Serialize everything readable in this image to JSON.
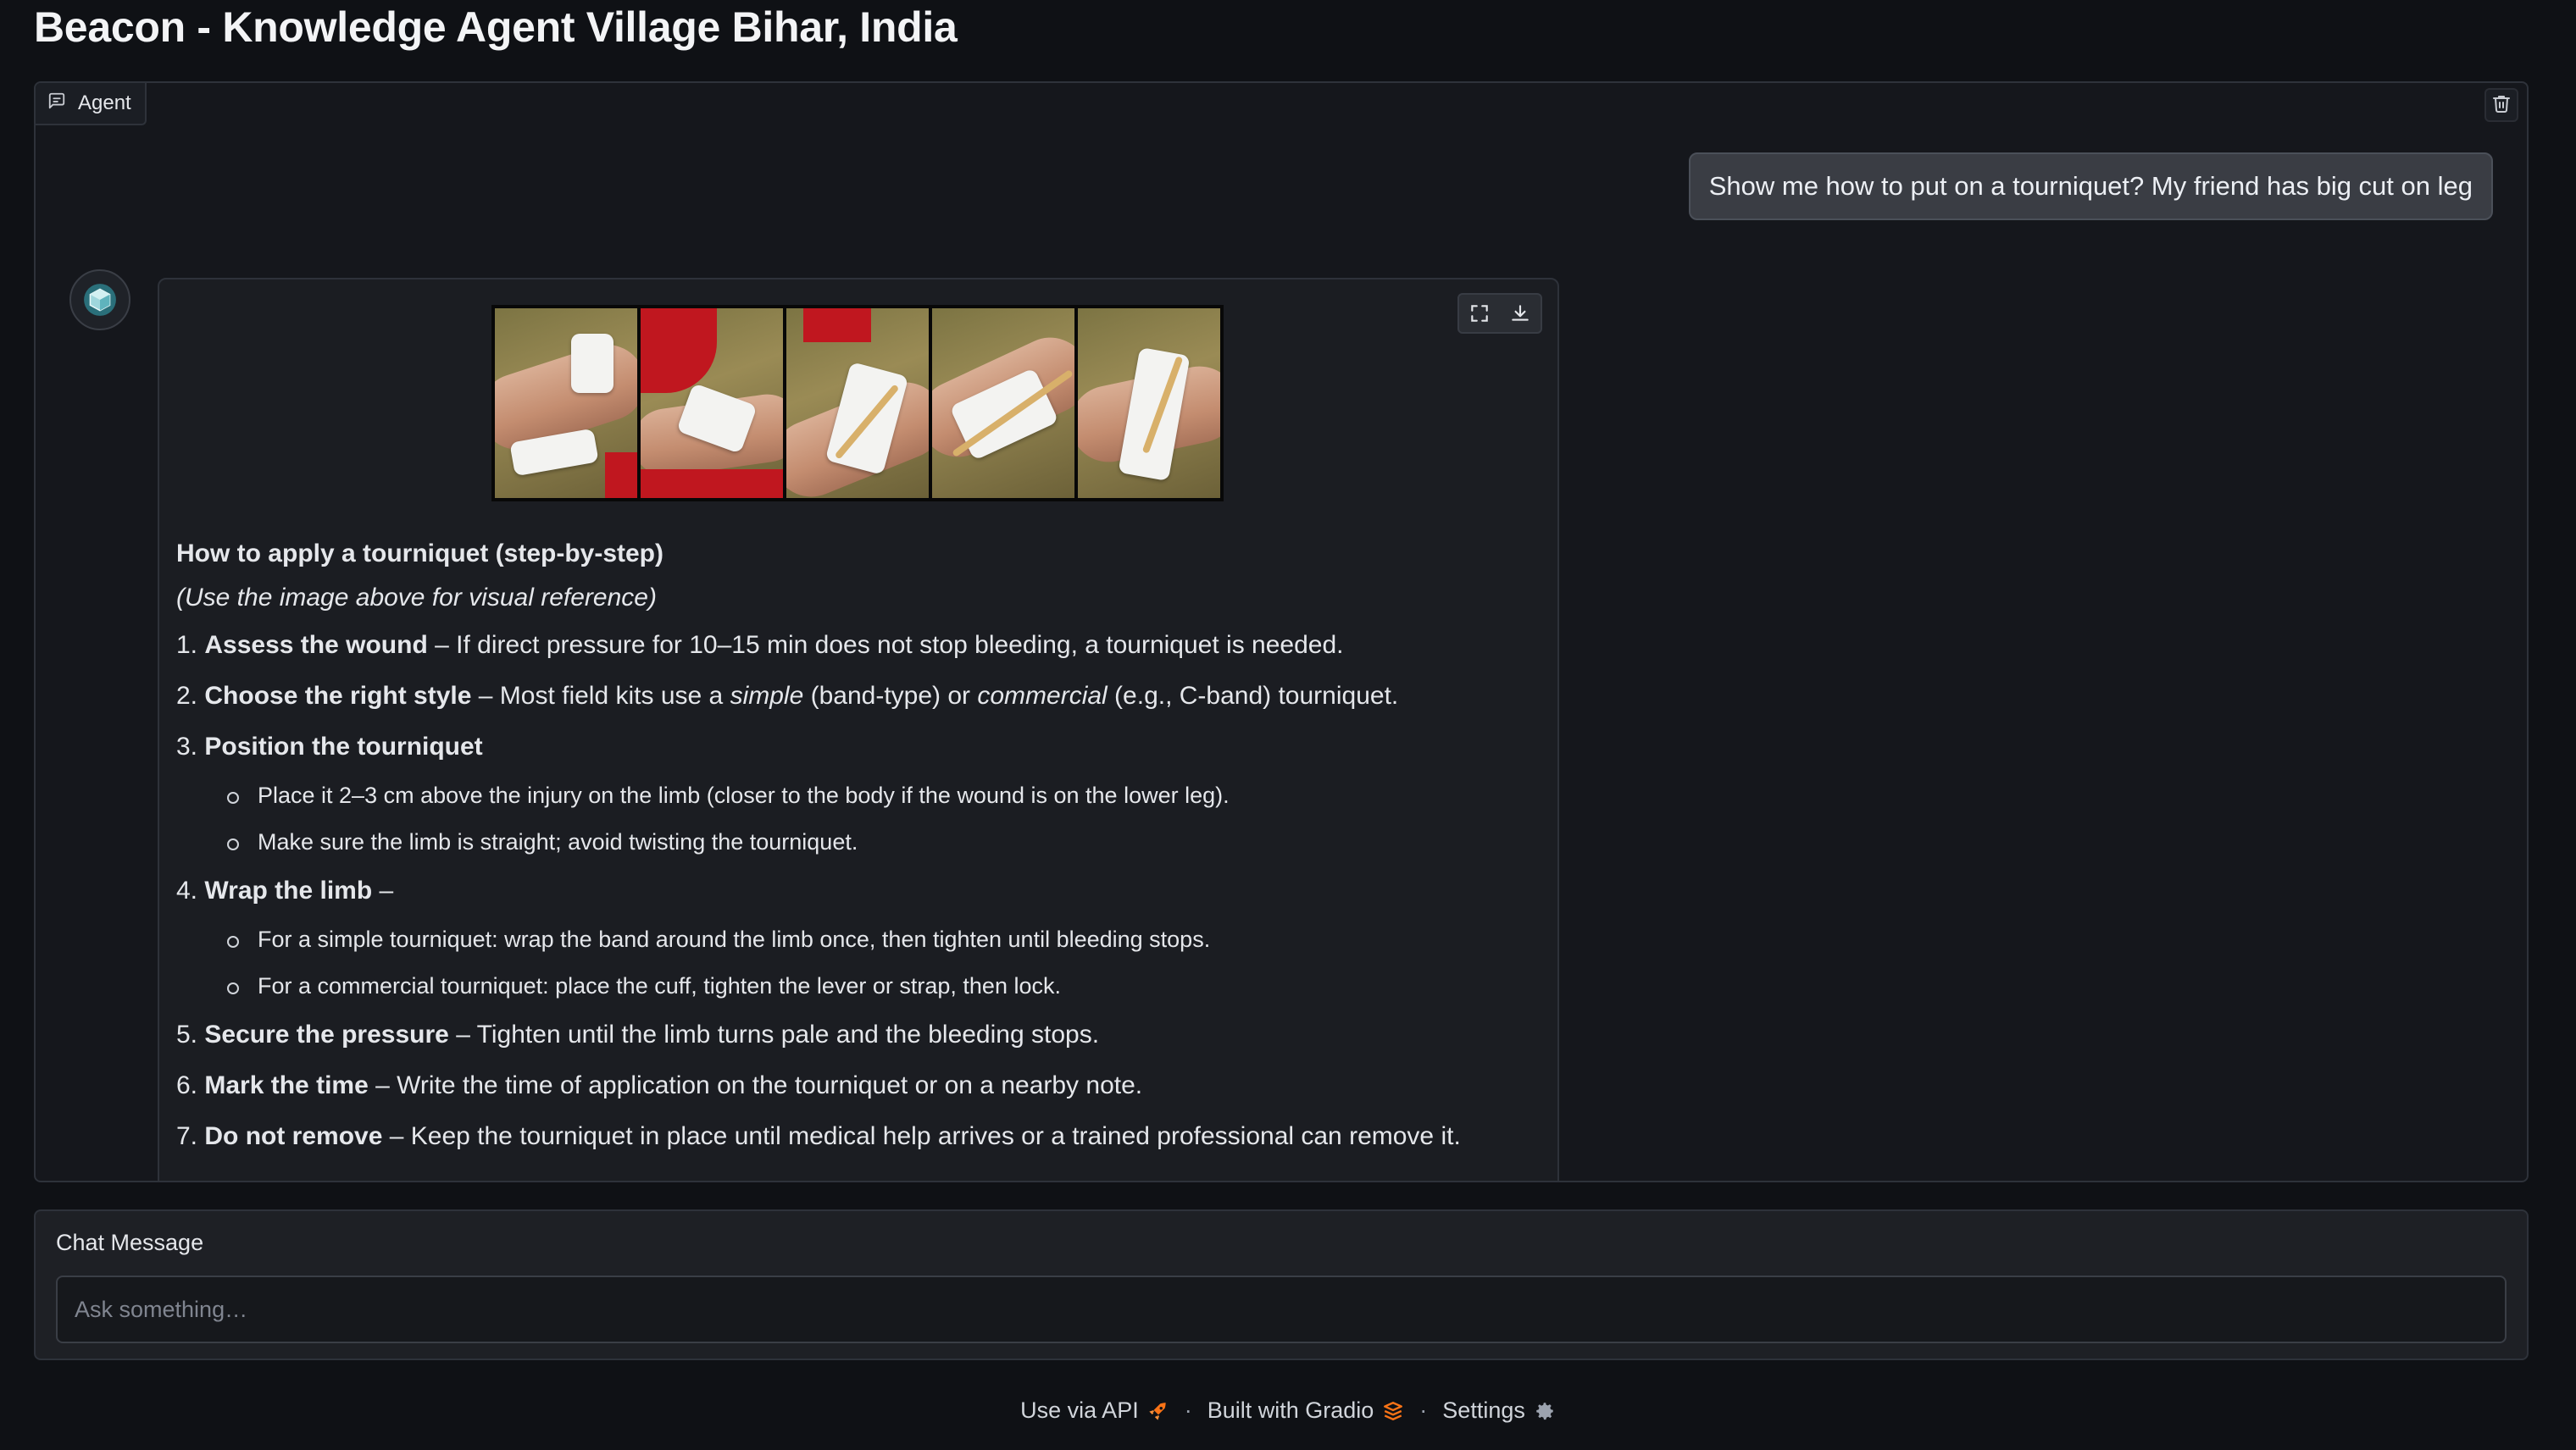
{
  "page_title": "Beacon - Knowledge Agent Village Bihar, India",
  "chat": {
    "tab_label": "Agent",
    "user_message": "Show me how to put on a tourniquet? My friend has big cut on leg",
    "bot": {
      "heading": "How to apply a tourniquet (step-by-step)",
      "subheading": "(Use the image above for visual reference)",
      "steps": [
        {
          "num": "1.",
          "title": "Assess the wound",
          "rest": " – If direct pressure for 10–15 min does not stop bleeding, a tourniquet is needed."
        },
        {
          "num": "2.",
          "title": "Choose the right style",
          "rest_a": " – Most field kits use a ",
          "em1": "simple",
          "rest_b": " (band-type) or ",
          "em2": "commercial",
          "rest_c": " (e.g., C-band) tourniquet."
        },
        {
          "num": "3.",
          "title": "Position the tourniquet",
          "subs": [
            "Place it 2–3 cm above the injury on the limb (closer to the body if the wound is on the lower leg).",
            "Make sure the limb is straight; avoid twisting the tourniquet."
          ]
        },
        {
          "num": "4.",
          "title": "Wrap the limb",
          "rest": " –",
          "subs": [
            "For a simple tourniquet: wrap the band around the limb once, then tighten until bleeding stops.",
            "For a commercial tourniquet: place the cuff, tighten the lever or strap, then lock."
          ]
        },
        {
          "num": "5.",
          "title": "Secure the pressure",
          "rest": " – Tighten until the limb turns pale and the bleeding stops."
        },
        {
          "num": "6.",
          "title": "Mark the time",
          "rest": " – Write the time of application on the tourniquet or on a nearby note."
        },
        {
          "num": "7.",
          "title": "Do not remove",
          "rest": " – Keep the tourniquet in place until medical help arrives or a trained professional can remove it."
        }
      ]
    }
  },
  "input": {
    "label": "Chat Message",
    "placeholder": "Ask something…"
  },
  "footer": {
    "api_label": "Use via API",
    "built_label": "Built with Gradio",
    "settings_label": "Settings",
    "separator": "·"
  },
  "icons": {
    "agent": "chat-bubble-icon",
    "trash": "trash-icon",
    "fullscreen": "fullscreen-icon",
    "download": "download-icon",
    "scroll": "arrow-down-icon",
    "api": "rocket-icon",
    "gradio": "gradio-logo-icon",
    "settings": "gear-icon"
  },
  "colors": {
    "background": "#0f1115",
    "panel": "#15171c",
    "user_bubble": "#3a3d44",
    "gradio_orange": "#f97316"
  }
}
